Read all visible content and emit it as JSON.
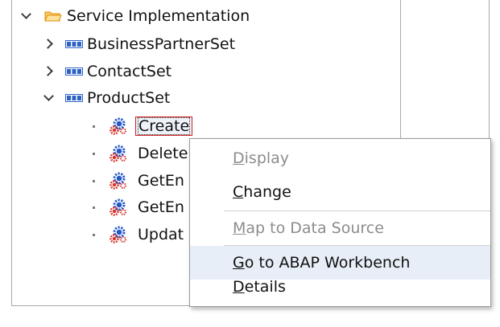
{
  "tree": {
    "root": {
      "label": "Service Implementation",
      "icon": "folder-open-icon",
      "expanded": true
    },
    "entity_sets": [
      {
        "label": "BusinessPartnerSet",
        "icon": "entity-set-icon",
        "expanded": false
      },
      {
        "label": "ContactSet",
        "icon": "entity-set-icon",
        "expanded": false
      },
      {
        "label": "ProductSet",
        "icon": "entity-set-icon",
        "expanded": true
      }
    ],
    "operations": [
      {
        "label": "Create",
        "icon": "gears-icon",
        "selected": true
      },
      {
        "label": "Delete",
        "icon": "gears-icon"
      },
      {
        "label": "GetEn",
        "icon": "gears-icon"
      },
      {
        "label": "GetEn",
        "icon": "gears-icon"
      },
      {
        "label": "Updat",
        "icon": "gears-icon"
      }
    ]
  },
  "context_menu": {
    "items": [
      {
        "key": "D",
        "rest": "isplay",
        "enabled": false
      },
      {
        "key": "C",
        "rest": "hange",
        "enabled": true
      },
      {
        "key": "M",
        "rest": "ap to Data Source",
        "enabled": false
      },
      {
        "key": "G",
        "rest": "o to ABAP Workbench",
        "enabled": true,
        "hovered": true
      },
      {
        "key": "D",
        "rest": "etails",
        "enabled": true
      }
    ]
  },
  "colors": {
    "folder": "#f5a623",
    "entity_icon": "#2f62c4",
    "gear_blue": "#2458c8",
    "gear_red": "#d93025",
    "selection_border": "#d21f1f",
    "menu_hover": "#e8eef7",
    "disabled_text": "#8c8c8c"
  }
}
